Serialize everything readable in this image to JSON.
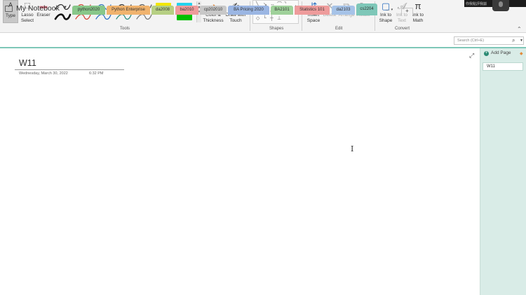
{
  "ribbon": {
    "type_label": "Type",
    "lasso_label": "Lasso\nSelect",
    "eraser_label": "Eraser",
    "tools_group": "Tools",
    "color_thickness_label": "Color &\nThickness",
    "draw_with_touch_label": "Draw with\nTouch",
    "shapes_group": "Shapes",
    "insert_space_label": "Insert\nSpace",
    "delete_label": "Delete",
    "arrange_label": "Arrange",
    "rotate_label": "Rotate",
    "edit_group": "Edit",
    "ink_to_shape_label": "Ink to\nShape",
    "ink_to_text_label": "Ink to\nText",
    "ink_to_math_label": "Ink to\nMath",
    "convert_group": "Convert",
    "pen_colors": [
      "#2b2b2b",
      "#d04030",
      "#2a6fc0",
      "#2b2b2b",
      "#555555",
      "#111111",
      "#d04030",
      "#2a6fc0",
      "#2b8a7a",
      "#777777"
    ],
    "highlighter_colors": [
      "#f2e600",
      "#22d3ee",
      "#00c000"
    ]
  },
  "camera": {
    "text": "你我點評我崩"
  },
  "notebook": {
    "name": "My Notebook",
    "more_tabs": "...",
    "add_tab": "+"
  },
  "sections": [
    {
      "label": "python2020",
      "color": "#88c78a"
    },
    {
      "label": "Python Enterprise",
      "color": "#f0b36e"
    },
    {
      "label": "da2008",
      "color": "#b6cf83"
    },
    {
      "label": "ba2010",
      "color": "#ee9c9c"
    },
    {
      "label": "cp202010",
      "color": "#c8c8c8"
    },
    {
      "label": "BA Pricing 2020",
      "color": "#9bb6e3"
    },
    {
      "label": "BA2101",
      "color": "#9fd19a"
    },
    {
      "label": "Statistics 101",
      "color": "#ee9c9c"
    },
    {
      "label": "da2103",
      "color": "#a6c3e8"
    },
    {
      "label": "cs2204",
      "color": "#7ec7b8",
      "active": true
    }
  ],
  "search": {
    "placeholder": "Search (Ctrl+E)"
  },
  "page": {
    "title": "W11",
    "date": "Wednesday, March 30, 2022",
    "time": "6:32 PM"
  },
  "pages_pane": {
    "add_page_label": "Add Page",
    "pages": [
      "W11"
    ]
  }
}
